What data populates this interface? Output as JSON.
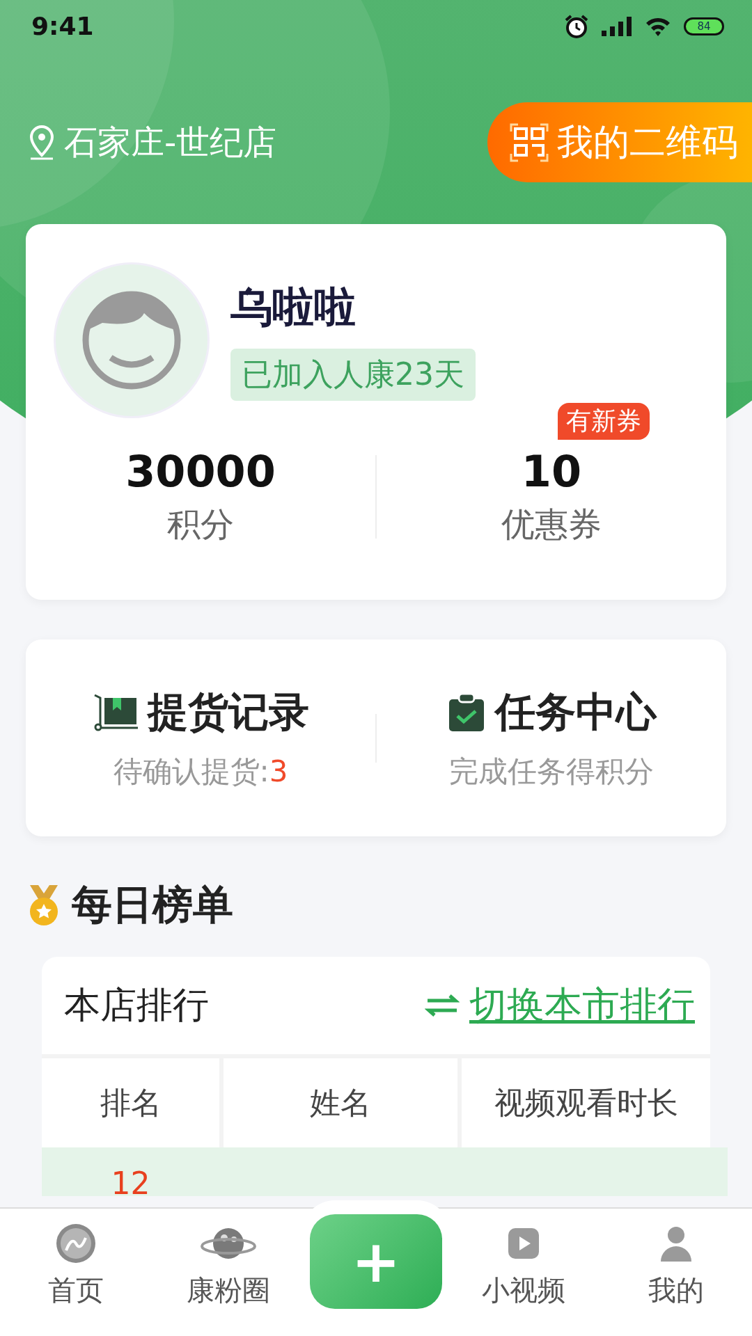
{
  "status_bar": {
    "time": "9:41",
    "battery": "84"
  },
  "header": {
    "location": "石家庄-世纪店",
    "qr_button": "我的二维码"
  },
  "profile": {
    "name": "乌啦啦",
    "badge": "已加入人康23天",
    "stats": [
      {
        "value": "30000",
        "label": "积分"
      },
      {
        "value": "10",
        "label": "优惠券",
        "tag": "有新券"
      }
    ]
  },
  "shortcuts": [
    {
      "title": "提货记录",
      "subtitle": "待确认提货:",
      "count": "3"
    },
    {
      "title": "任务中心",
      "subtitle": "完成任务得积分"
    }
  ],
  "ranking": {
    "title": "每日榜单",
    "scope": "本店排行",
    "switch_link": "切换本市排行",
    "columns": [
      "排名",
      "姓名",
      "视频观看时长"
    ],
    "rows": [
      {
        "rank": "12",
        "highlighted": true
      }
    ]
  },
  "tab_bar": [
    {
      "kind": "tab",
      "label": "首页"
    },
    {
      "kind": "tab",
      "label": "康粉圈"
    },
    {
      "kind": "add",
      "label": "+"
    },
    {
      "kind": "tab",
      "label": "小视频"
    },
    {
      "kind": "tab",
      "label": "我的"
    }
  ]
}
